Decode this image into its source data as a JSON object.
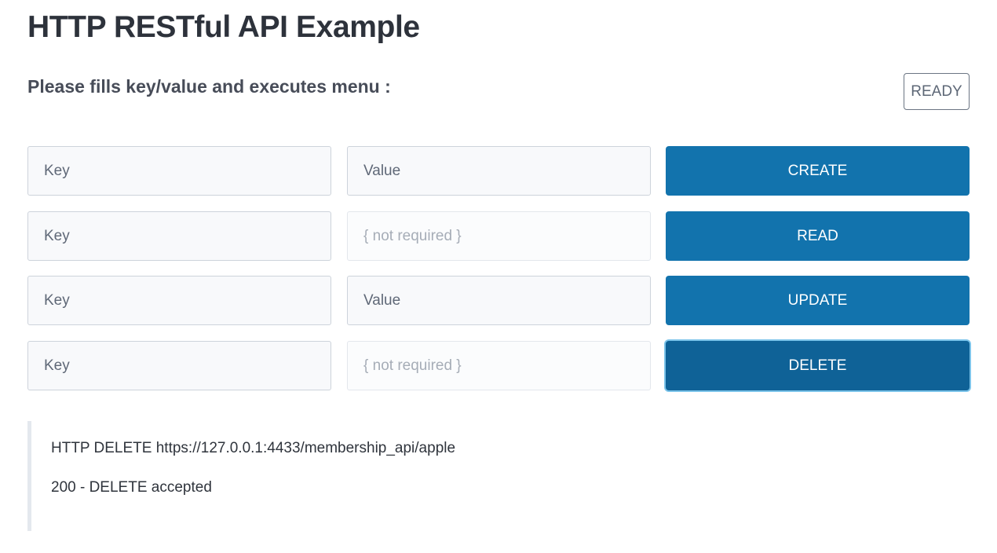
{
  "header": {
    "title": "HTTP RESTful API Example",
    "subtitle": "Please fills key/value and executes menu :",
    "status": "READY"
  },
  "rows": [
    {
      "key_placeholder": "Key",
      "value_placeholder": "Value",
      "action": "CREATE"
    },
    {
      "key_placeholder": "Key",
      "value_placeholder": "{ not required }",
      "action": "READ"
    },
    {
      "key_placeholder": "Key",
      "value_placeholder": "Value",
      "action": "UPDATE"
    },
    {
      "key_placeholder": "Key",
      "value_placeholder": "{ not required }",
      "action": "DELETE"
    }
  ],
  "result": {
    "request": "HTTP DELETE https://127.0.0.1:4433/membership_api/apple",
    "response": "200 - DELETE accepted"
  },
  "colors": {
    "primary_button": "#1273ad",
    "focused_button": "#0f6297",
    "focus_ring": "#7cc4ea"
  }
}
